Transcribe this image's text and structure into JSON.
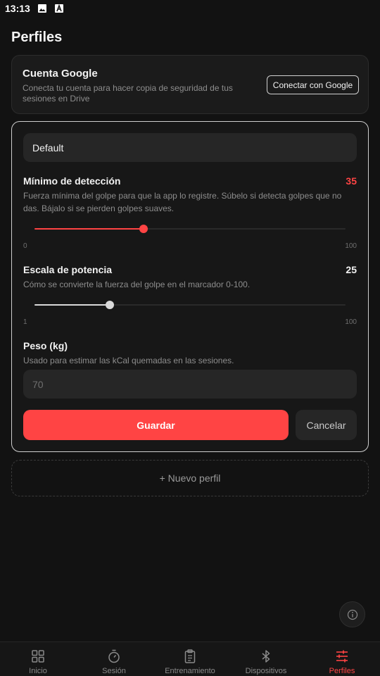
{
  "status_bar": {
    "time": "13:13",
    "icons": [
      "image-icon",
      "text-a-icon"
    ]
  },
  "page": {
    "title": "Perfiles"
  },
  "google": {
    "title": "Cuenta Google",
    "description": "Conecta tu cuenta para hacer copia de seguridad de tus sesiones en Drive",
    "button_label": "Conectar con Google"
  },
  "profile": {
    "name": "Default",
    "detection": {
      "label": "Mínimo de detección",
      "value": "35",
      "description": "Fuerza mínima del golpe para que la app lo registre. Súbelo si detecta golpes que no das. Bájalo si se pierden golpes suaves.",
      "min": "0",
      "max": "100",
      "fraction": 0.35,
      "color": "#ff4444"
    },
    "power": {
      "label": "Escala de potencia",
      "value": "25",
      "description": "Cómo se convierte la fuerza del golpe en el marcador 0-100.",
      "min": "1",
      "max": "100",
      "fraction": 0.242,
      "color": "#d9d9d9"
    },
    "weight": {
      "label": "Peso (kg)",
      "description": "Usado para estimar las kCal quemadas en las sesiones.",
      "placeholder": "70"
    },
    "save_label": "Guardar",
    "cancel_label": "Cancelar"
  },
  "new_profile_label": "+ Nuevo perfil",
  "colors": {
    "accent": "#ff4444",
    "background": "#121212",
    "card": "#1b1b1b"
  },
  "nav": {
    "items": [
      {
        "label": "Inicio",
        "icon": "grid-icon",
        "active": false
      },
      {
        "label": "Sesión",
        "icon": "stopwatch-icon",
        "active": false
      },
      {
        "label": "Entrenamiento",
        "icon": "clipboard-icon",
        "active": false
      },
      {
        "label": "Dispositivos",
        "icon": "bluetooth-icon",
        "active": false
      },
      {
        "label": "Perfiles",
        "icon": "sliders-icon",
        "active": true
      }
    ]
  }
}
